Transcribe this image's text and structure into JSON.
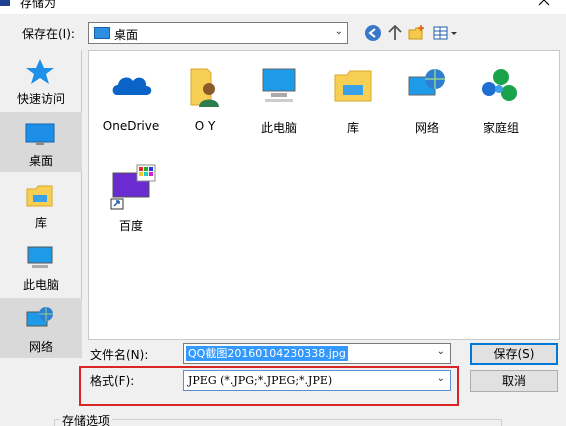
{
  "window": {
    "title": "存储为"
  },
  "save_in": {
    "label": "保存在(I):",
    "value": "桌面"
  },
  "places": [
    {
      "label": "快速访问",
      "icon": "star-icon"
    },
    {
      "label": "桌面",
      "icon": "desktop-icon",
      "selected": true
    },
    {
      "label": "库",
      "icon": "library-icon"
    },
    {
      "label": "此电脑",
      "icon": "computer-icon"
    },
    {
      "label": "网络",
      "icon": "network-icon"
    }
  ],
  "files": [
    {
      "label": "OneDrive",
      "icon": "onedrive-icon"
    },
    {
      "label": "O Y",
      "icon": "user-folder-icon"
    },
    {
      "label": "此电脑",
      "icon": "computer-icon"
    },
    {
      "label": "库",
      "icon": "library-icon"
    },
    {
      "label": "网络",
      "icon": "network-icon"
    },
    {
      "label": "家庭组",
      "icon": "homegroup-icon"
    },
    {
      "label": "百度",
      "icon": "shortcut-icon"
    }
  ],
  "filename": {
    "label": "文件名(N):",
    "value": "QQ截图20160104230338.jpg"
  },
  "format": {
    "label": "格式(F):",
    "value": "JPEG (*.JPG;*.JPEG;*.JPE)"
  },
  "buttons": {
    "save": "保存(S)",
    "cancel": "取消"
  },
  "options": {
    "label": "存储选项"
  },
  "colors": {
    "accent": "#0078d7",
    "highlight": "#d92525",
    "selection": "#3399ff"
  }
}
